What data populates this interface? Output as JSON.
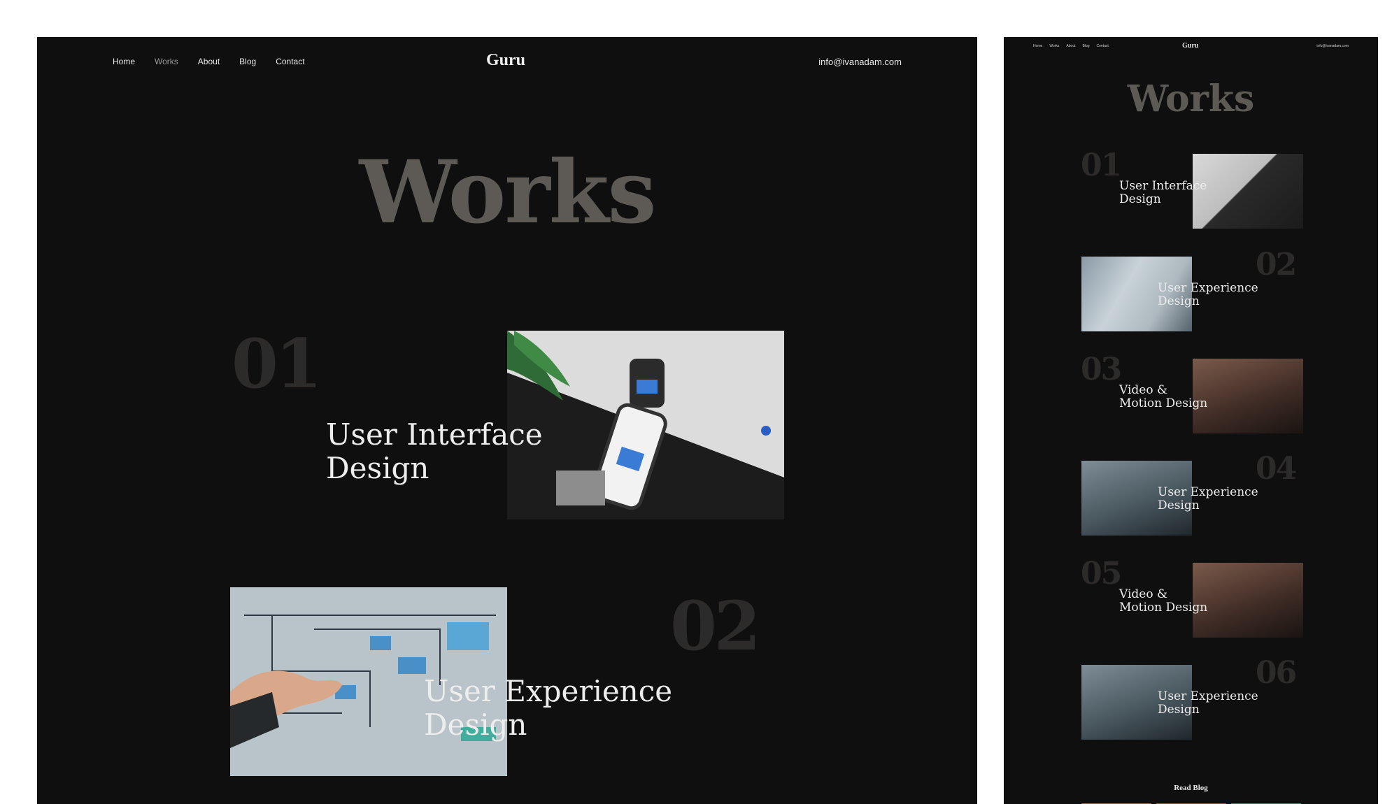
{
  "desktop": {
    "nav": {
      "items": [
        {
          "label": "Home"
        },
        {
          "label": "Works"
        },
        {
          "label": "About"
        },
        {
          "label": "Blog"
        },
        {
          "label": "Contact"
        }
      ],
      "active_index": 1
    },
    "logo": "Guru",
    "email": "info@ivanadam.com",
    "heading": "Works",
    "works": [
      {
        "number": "01",
        "title_line1": "User Interface",
        "title_line2": "Design",
        "thumb": "phone-mockup"
      },
      {
        "number": "02",
        "title_line1": "User Experience",
        "title_line2": "Design",
        "thumb": "whiteboard-wireframe"
      }
    ]
  },
  "preview": {
    "nav": {
      "items": [
        {
          "label": "Home"
        },
        {
          "label": "Works"
        },
        {
          "label": "About"
        },
        {
          "label": "Blog"
        },
        {
          "label": "Contact"
        }
      ]
    },
    "logo": "Guru",
    "email": "info@ivanadam.com",
    "heading": "Works",
    "works": [
      {
        "number": "01",
        "title_line1": "User Interface",
        "title_line2": "Design"
      },
      {
        "number": "02",
        "title_line1": "User Experience",
        "title_line2": "Design"
      },
      {
        "number": "03",
        "title_line1": "Video &",
        "title_line2": "Motion Design"
      },
      {
        "number": "04",
        "title_line1": "User Experience",
        "title_line2": "Design"
      },
      {
        "number": "05",
        "title_line1": "Video &",
        "title_line2": "Motion Design"
      },
      {
        "number": "06",
        "title_line1": "User Experience",
        "title_line2": "Design"
      }
    ],
    "read_blog": "Read Blog"
  },
  "colors": {
    "background": "#0f0f10",
    "heading": "#5d5a55",
    "numbers": "#2d2b2a",
    "text": "#ededed"
  }
}
